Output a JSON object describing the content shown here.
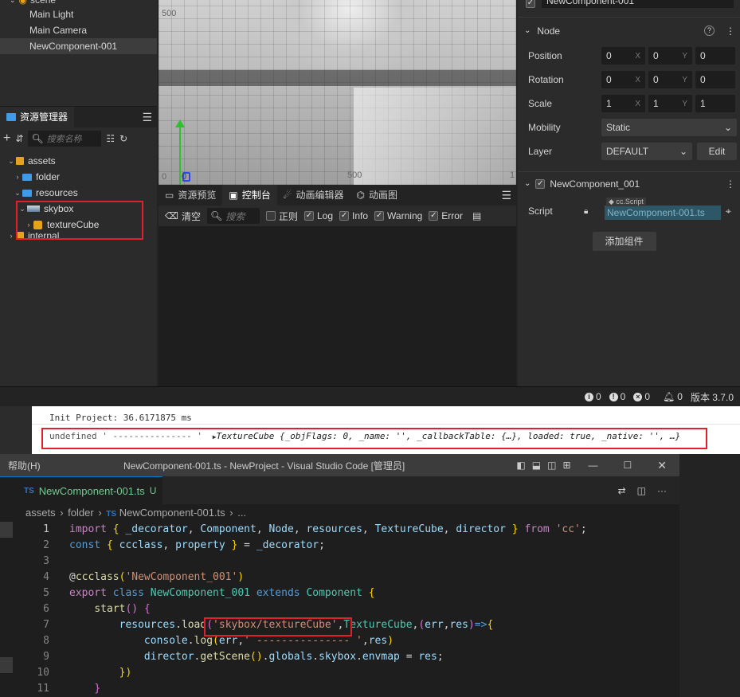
{
  "hierarchy": {
    "root": "scene",
    "items": [
      "Main Light",
      "Main Camera",
      "NewComponent-001"
    ]
  },
  "assets": {
    "tab_label": "资源管理器",
    "search_placeholder": "搜索名称",
    "tree": [
      "assets",
      "folder",
      "resources",
      "skybox",
      "textureCube",
      "internal"
    ]
  },
  "scene": {
    "tick_500_top": "500",
    "tick_0": "0",
    "tick_0b": "0",
    "tick_500_bottom": "500",
    "tick_1": "1"
  },
  "console": {
    "tabs": [
      "资源预览",
      "控制台",
      "动画编辑器",
      "动画图"
    ],
    "clear_label": "清空",
    "search_placeholder": "搜索",
    "regex_label": "正则",
    "filters": [
      "Log",
      "Info",
      "Warning",
      "Error"
    ]
  },
  "inspector": {
    "node_name": "NewComponent-001",
    "section_node": "Node",
    "position": {
      "label": "Position",
      "x": "0",
      "y": "0",
      "z": "0"
    },
    "rotation": {
      "label": "Rotation",
      "x": "0",
      "y": "0",
      "z": "0"
    },
    "scale": {
      "label": "Scale",
      "x": "1",
      "y": "1",
      "z": "1"
    },
    "axis_x": "X",
    "axis_y": "Y",
    "mobility": {
      "label": "Mobility",
      "value": "Static"
    },
    "layer": {
      "label": "Layer",
      "value": "DEFAULT",
      "edit": "Edit"
    },
    "component": "NewComponent_001",
    "script": {
      "label": "Script",
      "type_tag": "cc.Script",
      "value": "NewComponent-001.ts"
    },
    "add_component": "添加组件"
  },
  "status": {
    "counts": [
      "0",
      "0",
      "0",
      "0"
    ],
    "version": "版本 3.7.0"
  },
  "devtools": {
    "line1": "Init Project: 36.6171875 ms",
    "line2_prefix": "undefined ' --------------- '",
    "line2_obj": "TextureCube {_objFlags: 0, _name: '', _callbackTable: {…}, loaded: true, _native: '', …}"
  },
  "vscode": {
    "menu": "帮助(H)",
    "title": "NewComponent-001.ts - NewProject - Visual Studio Code [管理员]",
    "tab_label": "NewComponent-001.ts",
    "tab_status": "U",
    "breadcrumb": [
      "assets",
      "folder",
      "NewComponent-001.ts",
      "..."
    ],
    "line_numbers": [
      "1",
      "2",
      "3",
      "4",
      "5",
      "6",
      "7",
      "8",
      "9",
      "10",
      "11"
    ]
  },
  "colors": {
    "accent_blue": "#3d9be9",
    "highlight_red": "#e0202c",
    "editor_bg": "#1e1e1e",
    "panel_bg": "#2b2b2b"
  }
}
